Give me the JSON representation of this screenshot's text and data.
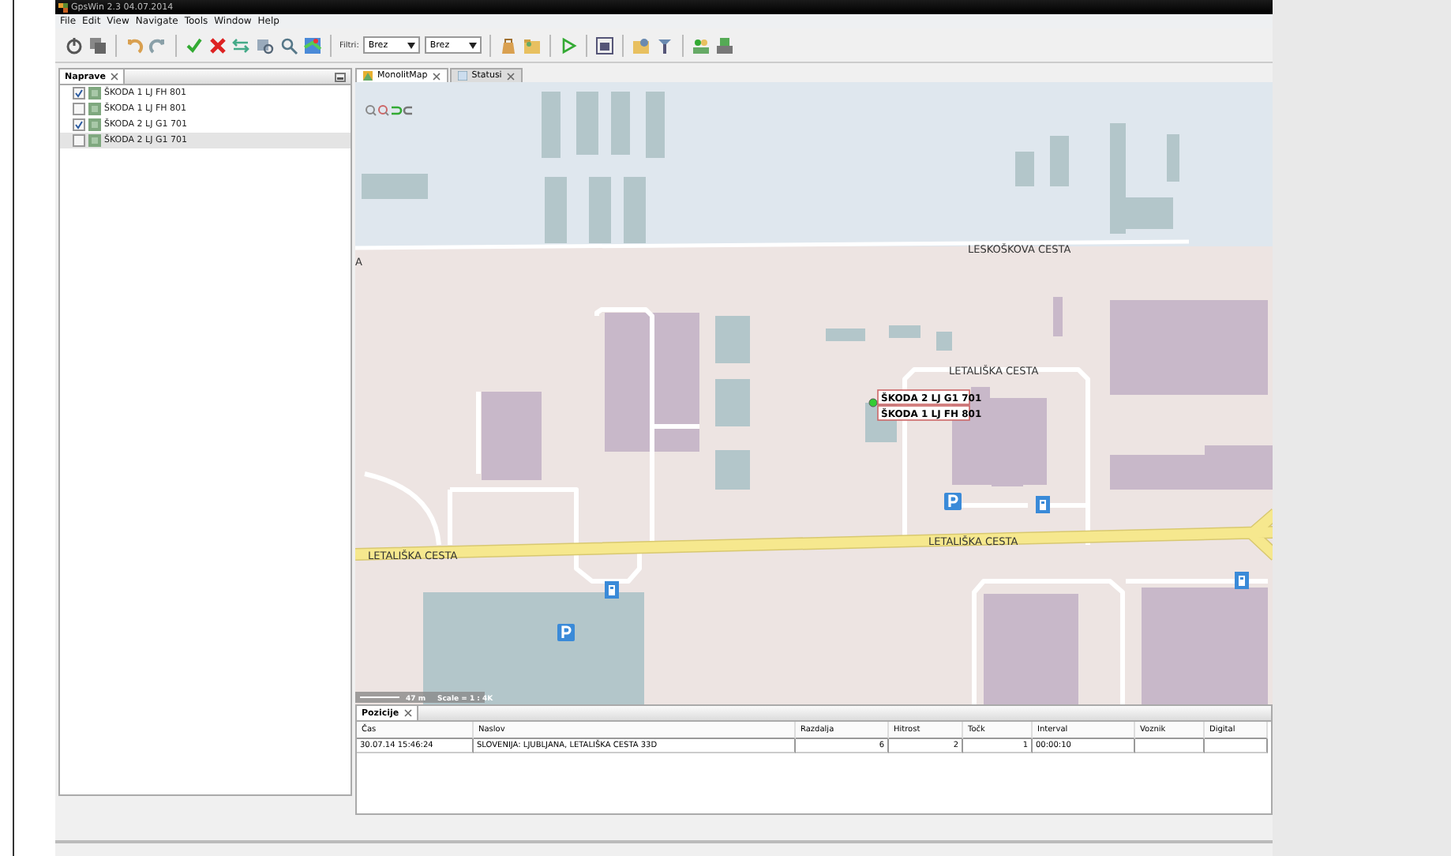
{
  "window": {
    "title": "GpsWin 2.3 04.07.2014"
  },
  "menu": [
    "File",
    "Edit",
    "View",
    "Navigate",
    "Tools",
    "Window",
    "Help"
  ],
  "filter": {
    "label": "Filtri:",
    "selects": [
      {
        "value": "Brez"
      },
      {
        "value": "Brez"
      }
    ]
  },
  "devices_panel": {
    "title": "Naprave",
    "items": [
      {
        "label": "ŠKODA 1 LJ FH 801",
        "checked": true,
        "selected": false
      },
      {
        "label": "ŠKODA 1 LJ FH 801",
        "checked": false,
        "selected": false
      },
      {
        "label": "ŠKODA 2 LJ G1 701",
        "checked": true,
        "selected": false
      },
      {
        "label": "ŠKODA 2 LJ G1 701",
        "checked": false,
        "selected": true
      }
    ]
  },
  "tabs": [
    {
      "label": "MonolitMap",
      "selected": true
    },
    {
      "label": "Statusi",
      "selected": false
    }
  ],
  "map": {
    "street_labels": [
      "LESKOŠKOVA CESTA",
      "A",
      "LETALIŠKA CESTA",
      "LETALIŠKA CESTA",
      "LETALIŠKA CESTA"
    ],
    "vehicle_labels": [
      "ŠKODA 2 LJ G1 701",
      "ŠKODA 1 LJ FH 801"
    ],
    "scale": {
      "distance": "47 m",
      "ratio": "Scale = 1 : 4K"
    }
  },
  "positions_panel": {
    "title": "Pozicije",
    "columns": [
      "Čas",
      "Naslov",
      "Razdalja",
      "Hitrost",
      "Točk",
      "Interval",
      "Voznik",
      "Digital"
    ],
    "rows": [
      [
        "30.07.14 15:46:24",
        "SLOVENIJA: LJUBLJANA, LETALIŠKA CESTA 33D",
        "6",
        "2",
        "1",
        "00:00:10"
      ]
    ]
  }
}
